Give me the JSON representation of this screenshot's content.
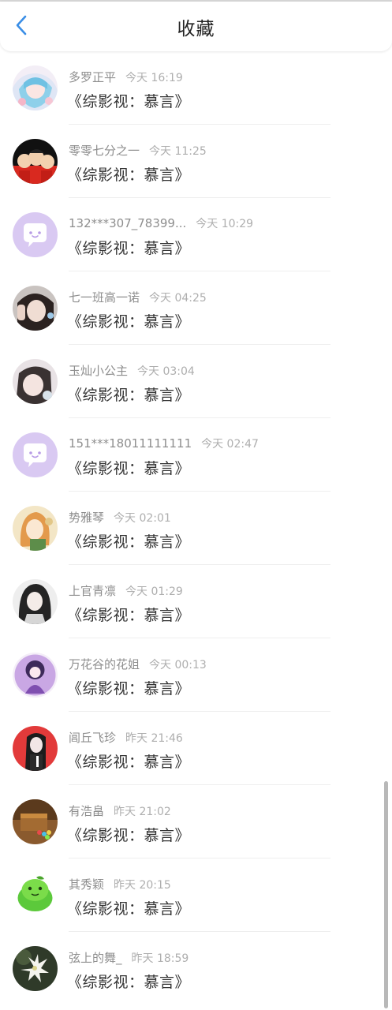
{
  "header": {
    "title": "收藏",
    "back_icon": "chevron-left-icon",
    "accent_color": "#3a8ee6"
  },
  "items": [
    {
      "name": "多罗正平",
      "time": "今天 16:19",
      "book": "《综影视：慕言》",
      "avatar": "anime-girl-pastel"
    },
    {
      "name": "零零七分之一",
      "time": "今天 11:25",
      "book": "《综影视：慕言》",
      "avatar": "cartoon-family"
    },
    {
      "name": "132***307_78399...",
      "time": "今天 10:29",
      "book": "《综影视：慕言》",
      "avatar": "default-chat-bubble"
    },
    {
      "name": "七一班高一诺",
      "time": "今天 04:25",
      "book": "《综影视：慕言》",
      "avatar": "girl-selfie"
    },
    {
      "name": "玉灿小公主",
      "time": "今天 03:04",
      "book": "《综影视：慕言》",
      "avatar": "girl-portrait"
    },
    {
      "name": "151***18011111111",
      "time": "今天 02:47",
      "book": "《综影视：慕言》",
      "avatar": "default-chat-bubble"
    },
    {
      "name": "势雅琴",
      "time": "今天 02:01",
      "book": "《综影视：慕言》",
      "avatar": "anime-orange-hair"
    },
    {
      "name": "上官青凛",
      "time": "今天 01:29",
      "book": "《综影视：慕言》",
      "avatar": "anime-dark-hair"
    },
    {
      "name": "万花谷的花姐",
      "time": "今天 00:13",
      "book": "《综影视：慕言》",
      "avatar": "purple-chibi"
    },
    {
      "name": "阊丘飞珍",
      "time": "昨天 21:46",
      "book": "《综影视：慕言》",
      "avatar": "red-anime-boy"
    },
    {
      "name": "有浩畠",
      "time": "昨天 21:02",
      "book": "《综影视：慕言》",
      "avatar": "treasure-chest"
    },
    {
      "name": "其秀颖",
      "time": "昨天 20:15",
      "book": "《综影视：慕言》",
      "avatar": "green-turtle"
    },
    {
      "name": "弦上的舞_",
      "time": "昨天 18:59",
      "book": "《综影视：慕言》",
      "avatar": "white-flower"
    }
  ]
}
